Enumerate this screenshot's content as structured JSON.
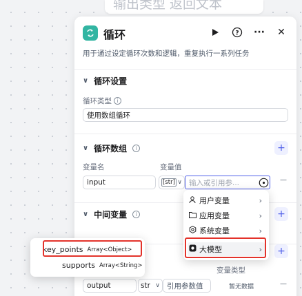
{
  "background_node": {
    "title": "输出类型 返回文本"
  },
  "node": {
    "title": "循环",
    "description": "用于通过设定循环次数和逻辑，重复执行一系列任务",
    "icons": {
      "logo": "loop-icon",
      "run": "play-icon",
      "help": "help-icon",
      "more": "more-icon",
      "close": "close-icon"
    },
    "help_glyph": "?",
    "more_glyph": "···",
    "close_glyph": "✕"
  },
  "loop_settings": {
    "title": "循环设置",
    "type_label": "循环类型",
    "type_value": "使用数组循环"
  },
  "loop_array": {
    "title": "循环数组",
    "name_header": "变量名",
    "value_header": "变量值",
    "rows": [
      {
        "name": "input",
        "type_tag": "[str]",
        "placeholder": "输入或引用参..."
      }
    ],
    "add_label": "+",
    "remove_label": "—"
  },
  "intermediate_vars": {
    "title": "中间变量",
    "add_label": "+"
  },
  "output_section": {
    "add_label": "+",
    "type_header": "变量类型",
    "rows": [
      {
        "name": "output",
        "type_tag": "str",
        "placeholder": "引用参数值",
        "type_value": "暂无数据"
      }
    ],
    "remove_label": "—"
  },
  "variable_menu": {
    "items": [
      {
        "label": "用户变量",
        "icon": "user-icon"
      },
      {
        "label": "应用变量",
        "icon": "folder-icon"
      },
      {
        "label": "系统变量",
        "icon": "gear-icon"
      },
      {
        "label": "大模型",
        "icon": "llm-icon",
        "active": true
      }
    ]
  },
  "llm_submenu": {
    "items": [
      {
        "name": "key_points",
        "type": "Array<Object>",
        "active": true
      },
      {
        "name": "supports",
        "type": "Array<String>"
      }
    ]
  },
  "colors": {
    "accent": "#4e5ee8",
    "highlight": "#e3322a",
    "logo": "#32b5a2"
  }
}
